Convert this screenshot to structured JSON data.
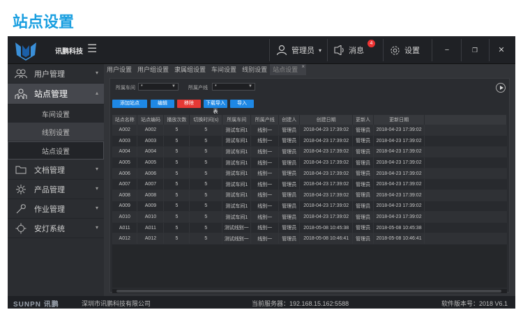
{
  "page": {
    "heading": "站点设置"
  },
  "header": {
    "brand": "讯鹏科技",
    "user": "管理员",
    "messages": "消息",
    "message_count": "4",
    "settings": "设置"
  },
  "sidebar": {
    "items": [
      {
        "label": "用户管理"
      },
      {
        "label": "站点管理"
      },
      {
        "label": "文档管理"
      },
      {
        "label": "产品管理"
      },
      {
        "label": "作业管理"
      },
      {
        "label": "安灯系统"
      }
    ],
    "subitems": [
      {
        "label": "车间设置"
      },
      {
        "label": "线别设置"
      },
      {
        "label": "站点设置"
      }
    ]
  },
  "tabs": [
    {
      "label": "用户设置"
    },
    {
      "label": "用户组设置"
    },
    {
      "label": "隶属组设置"
    },
    {
      "label": "车间设置"
    },
    {
      "label": "线别设置"
    },
    {
      "label": "站点设置"
    }
  ],
  "filters": {
    "workshop_label": "所属车间",
    "workshop_value": "*",
    "line_label": "所属产线",
    "line_value": "*"
  },
  "toolbar": {
    "add": "添加站点",
    "edit": "编辑",
    "delete": "移除",
    "import": "下载导入表",
    "export": "导入"
  },
  "table": {
    "columns": [
      "站点名称",
      "站点编码",
      "播放次数",
      "切换时间(s)",
      "所属车间",
      "所属产线",
      "创建人",
      "创建日期",
      "更新人",
      "更新日期"
    ],
    "rows": [
      [
        "A002",
        "A002",
        "5",
        "5",
        "测试车间1",
        "线别一",
        "管理员",
        "2018-04-23 17:39:02",
        "管理员",
        "2018-04-23 17:39:02"
      ],
      [
        "A003",
        "A003",
        "5",
        "5",
        "测试车间1",
        "线别一",
        "管理员",
        "2018-04-23 17:39:02",
        "管理员",
        "2018-04-23 17:39:02"
      ],
      [
        "A004",
        "A004",
        "5",
        "5",
        "测试车间1",
        "线别一",
        "管理员",
        "2018-04-23 17:39:02",
        "管理员",
        "2018-04-23 17:39:02"
      ],
      [
        "A005",
        "A005",
        "5",
        "5",
        "测试车间1",
        "线别一",
        "管理员",
        "2018-04-23 17:39:02",
        "管理员",
        "2018-04-23 17:39:02"
      ],
      [
        "A006",
        "A006",
        "5",
        "5",
        "测试车间1",
        "线别一",
        "管理员",
        "2018-04-23 17:39:02",
        "管理员",
        "2018-04-23 17:39:02"
      ],
      [
        "A007",
        "A007",
        "5",
        "5",
        "测试车间1",
        "线别一",
        "管理员",
        "2018-04-23 17:39:02",
        "管理员",
        "2018-04-23 17:39:02"
      ],
      [
        "A008",
        "A008",
        "5",
        "5",
        "测试车间1",
        "线别一",
        "管理员",
        "2018-04-23 17:39:02",
        "管理员",
        "2018-04-23 17:39:02"
      ],
      [
        "A009",
        "A009",
        "5",
        "5",
        "测试车间1",
        "线别一",
        "管理员",
        "2018-04-23 17:39:02",
        "管理员",
        "2018-04-23 17:39:02"
      ],
      [
        "A010",
        "A010",
        "5",
        "5",
        "测试车间1",
        "线别一",
        "管理员",
        "2018-04-23 17:39:02",
        "管理员",
        "2018-04-23 17:39:02"
      ],
      [
        "A011",
        "A011",
        "5",
        "5",
        "测试线别一",
        "线别一",
        "管理员",
        "2018-05-08 10:45:38",
        "管理员",
        "2018-05-08 10:45:38"
      ],
      [
        "A012",
        "A012",
        "5",
        "5",
        "测试线别一",
        "线别一",
        "管理员",
        "2018-05-08 10:46:41",
        "管理员",
        "2018-05-08 10:46:41"
      ]
    ]
  },
  "footer": {
    "logo_text": "SUNPN 讯鹏",
    "company": "深圳市讯鹏科技有限公司",
    "server": "当前服务器：192.168.15.162:5588",
    "version": "软件版本号：2018 V6.1"
  },
  "colors": {
    "heading": "#1a9fe0",
    "button_blue": "#1e88e5",
    "button_red": "#e53935",
    "badge": "#ee3333"
  },
  "icons": [
    "logo-icon",
    "menu-icon",
    "user-icon",
    "chevron-down-icon",
    "message-icon",
    "gear-icon",
    "minimize-icon",
    "restore-icon",
    "close-icon",
    "users-icon",
    "site-icon",
    "folder-icon",
    "product-icon",
    "wrench-icon",
    "andon-icon",
    "play-icon"
  ]
}
